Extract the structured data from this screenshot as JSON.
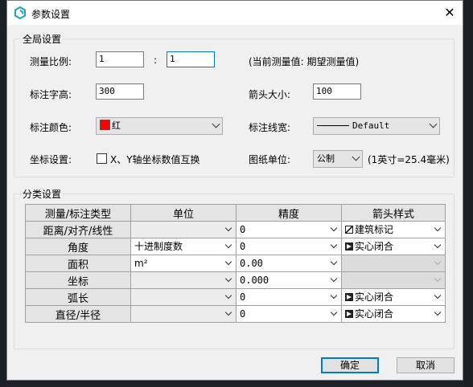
{
  "window": {
    "title": "参数设置"
  },
  "global": {
    "group_title": "全局设置",
    "scale_label": "测量比例:",
    "scale_value_a": "1",
    "scale_separator": ":",
    "scale_value_b": "1",
    "scale_hint": "(当前测量值: 期望测量值)",
    "text_height_label": "标注字高:",
    "text_height_value": "300",
    "arrow_size_label": "箭头大小:",
    "arrow_size_value": "100",
    "color_label": "标注颜色:",
    "color_value": "红",
    "color_hex": "#ff0000",
    "linewidth_label": "标注线宽:",
    "linewidth_value": "Default",
    "coord_label": "坐标设置:",
    "coord_checkbox_label": "X、Y轴坐标数值互换",
    "coord_checked": false,
    "unit_label": "图纸单位:",
    "unit_value": "公制",
    "unit_hint": "(1英寸=25.4毫米)"
  },
  "category": {
    "group_title": "分类设置",
    "headers": [
      "测量/标注类型",
      "单位",
      "精度",
      "箭头样式"
    ],
    "rows": [
      {
        "type": "距离/对齐/线性",
        "unit": "",
        "precision": "0",
        "arrow": "建筑标记",
        "arrow_icon": "oblique-tick-icon"
      },
      {
        "type": "角度",
        "unit": "十进制度数",
        "precision": "0",
        "arrow": "实心闭合",
        "arrow_icon": "closed-filled-arrow-icon"
      },
      {
        "type": "面积",
        "unit": "m²",
        "precision": "0.00",
        "arrow": "",
        "arrow_icon": ""
      },
      {
        "type": "坐标",
        "unit": "",
        "precision": "0.000",
        "arrow": "",
        "arrow_icon": ""
      },
      {
        "type": "弧长",
        "unit": "",
        "precision": "0",
        "arrow": "实心闭合",
        "arrow_icon": "closed-filled-arrow-icon"
      },
      {
        "type": "直径/半径",
        "unit": "",
        "precision": "0",
        "arrow": "实心闭合",
        "arrow_icon": "closed-filled-arrow-icon"
      }
    ]
  },
  "buttons": {
    "ok": "确定",
    "cancel": "取消"
  }
}
